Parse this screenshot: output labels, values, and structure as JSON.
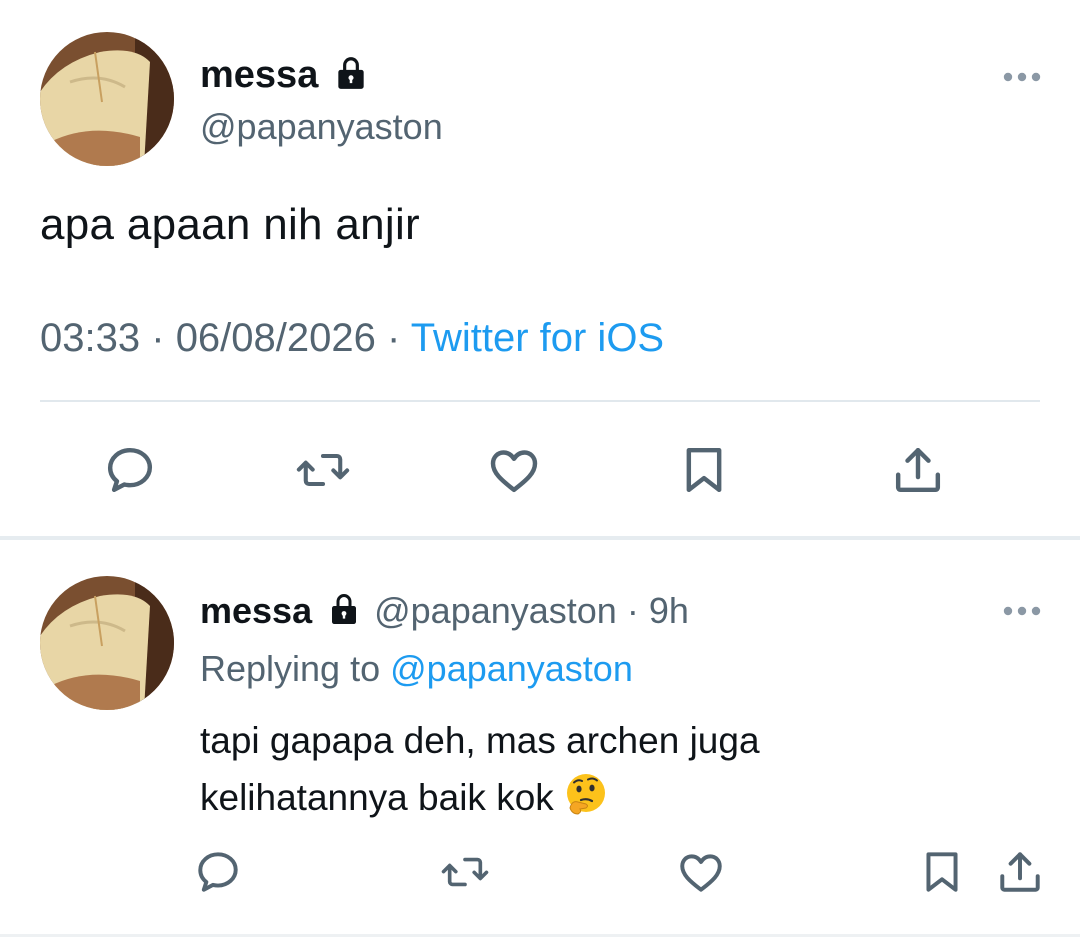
{
  "main_tweet": {
    "display_name": "messa",
    "handle": "@papanyaston",
    "text": "apa apaan nih anjir",
    "time": "03:33",
    "date": "06/08/2026",
    "separator": "·",
    "source": "Twitter for iOS",
    "actions": [
      "reply-icon",
      "retweet-icon",
      "like-icon",
      "bookmark-icon",
      "share-icon"
    ]
  },
  "reply_tweet": {
    "display_name": "messa",
    "handle": "@papanyaston",
    "age": "9h",
    "separator": "·",
    "replying_prefix": "Replying to",
    "replying_mention": "@papanyaston",
    "text_line1": "tapi gapapa deh, mas archen juga",
    "text_line2": "kelihatannya baik kok",
    "emoji": "thinking-face-emoji",
    "actions": [
      "reply-icon",
      "retweet-icon",
      "like-icon",
      "bookmark-icon",
      "share-icon"
    ]
  },
  "colors": {
    "text_primary": "#0f1419",
    "text_secondary": "#536471",
    "accent": "#1d9bf0",
    "divider": "#e1e8ed"
  }
}
